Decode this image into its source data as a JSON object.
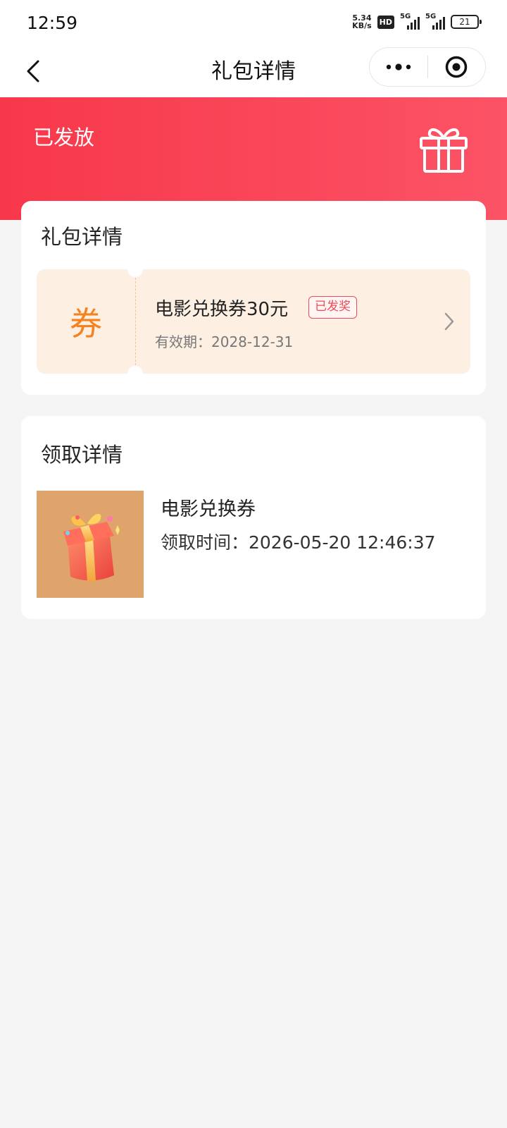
{
  "status_bar": {
    "time": "12:59",
    "net_speed_value": "5.34",
    "net_speed_unit": "KB/s",
    "hd_label": "HD",
    "network_1": "5G",
    "network_2": "5G",
    "battery": "21"
  },
  "nav": {
    "title": "礼包详情",
    "back_icon": "chevron-left-icon",
    "more_icon": "more-dots-icon",
    "close_icon": "target-circle-icon"
  },
  "hero": {
    "status": "已发放",
    "icon": "gift-icon",
    "gradient_start": "#f7384a",
    "gradient_end": "#fc5366"
  },
  "gift_card": {
    "title": "礼包详情",
    "coupon": {
      "char": "券",
      "name": "电影兑换券30元",
      "badge": "已发奖",
      "expiry": "有效期：2028-12-31",
      "accent_color": "#f5821f",
      "bg_color": "#fdf0e3"
    }
  },
  "receive_card": {
    "title": "领取详情",
    "item": {
      "image": "gift-box-image",
      "name": "电影兑换券",
      "time": "领取时间：2026-05-20 12:46:37"
    }
  }
}
